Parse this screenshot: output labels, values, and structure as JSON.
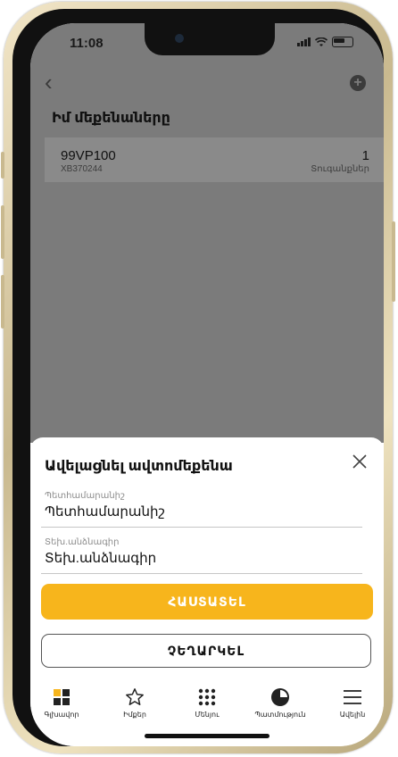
{
  "status_bar": {
    "time": "11:08"
  },
  "header": {
    "title": "Իմ մեքենաները"
  },
  "vehicles": [
    {
      "plate": "99VP100",
      "vin": "XB370244",
      "count": "1",
      "count_label": "Տուգանքներ"
    }
  ],
  "sheet": {
    "title": "Ավելացնել ավտոմեքենա",
    "fields": [
      {
        "label": "Պետհամարանիշ",
        "value": "Պետհամարանիշ"
      },
      {
        "label": "Տեխ.անձնագիր",
        "value": "Տեխ.անձնագիր"
      }
    ],
    "confirm_label": "ՀԱՍՏԱՏԵԼ",
    "cancel_label": "ՉԵՂԱՐԿԵԼ"
  },
  "tabs": [
    {
      "label": "Գլխավոր",
      "icon": "home-grid-icon"
    },
    {
      "label": "Իմքեր",
      "icon": "star-icon"
    },
    {
      "label": "Մենյու",
      "icon": "dots-grid-icon"
    },
    {
      "label": "Պատմություն",
      "icon": "pie-icon"
    },
    {
      "label": "Ավելին",
      "icon": "menu-icon"
    }
  ],
  "colors": {
    "accent": "#f7b51c",
    "overlay": "#7b7b7b"
  }
}
